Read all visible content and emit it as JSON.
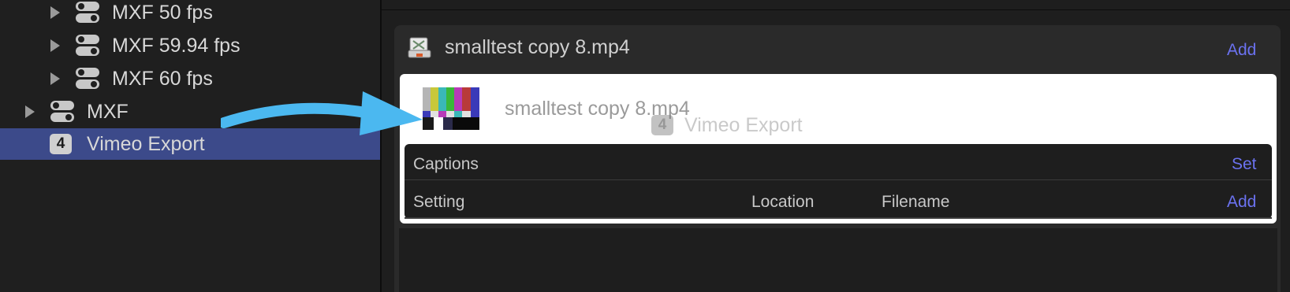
{
  "sidebar": {
    "items": [
      {
        "label": "MXF 50 fps",
        "icon": "toggle-settings-icon",
        "level": 1
      },
      {
        "label": "MXF 59.94 fps",
        "icon": "toggle-settings-icon",
        "level": 1
      },
      {
        "label": "MXF 60 fps",
        "icon": "toggle-settings-icon",
        "level": 1
      },
      {
        "label": "MXF",
        "icon": "toggle-settings-icon",
        "level": 0
      },
      {
        "label": "Vimeo Export",
        "icon": "number-4-badge-icon",
        "badge": "4",
        "level": 0,
        "selected": true
      }
    ]
  },
  "job": {
    "title": "smalltest copy 8.mp4",
    "add_label": "Add",
    "file_name": "smalltest copy 8.mp4",
    "drag_badge": "4",
    "drag_label": "Vimeo Export"
  },
  "captions": {
    "title": "Captions",
    "set_label": "Set",
    "columns": {
      "setting": "Setting",
      "location": "Location",
      "filename": "Filename"
    },
    "add_label": "Add"
  },
  "colors": {
    "accent": "#6b72f0",
    "selection": "#3c4a8a",
    "arrow": "#4bb8f0"
  }
}
